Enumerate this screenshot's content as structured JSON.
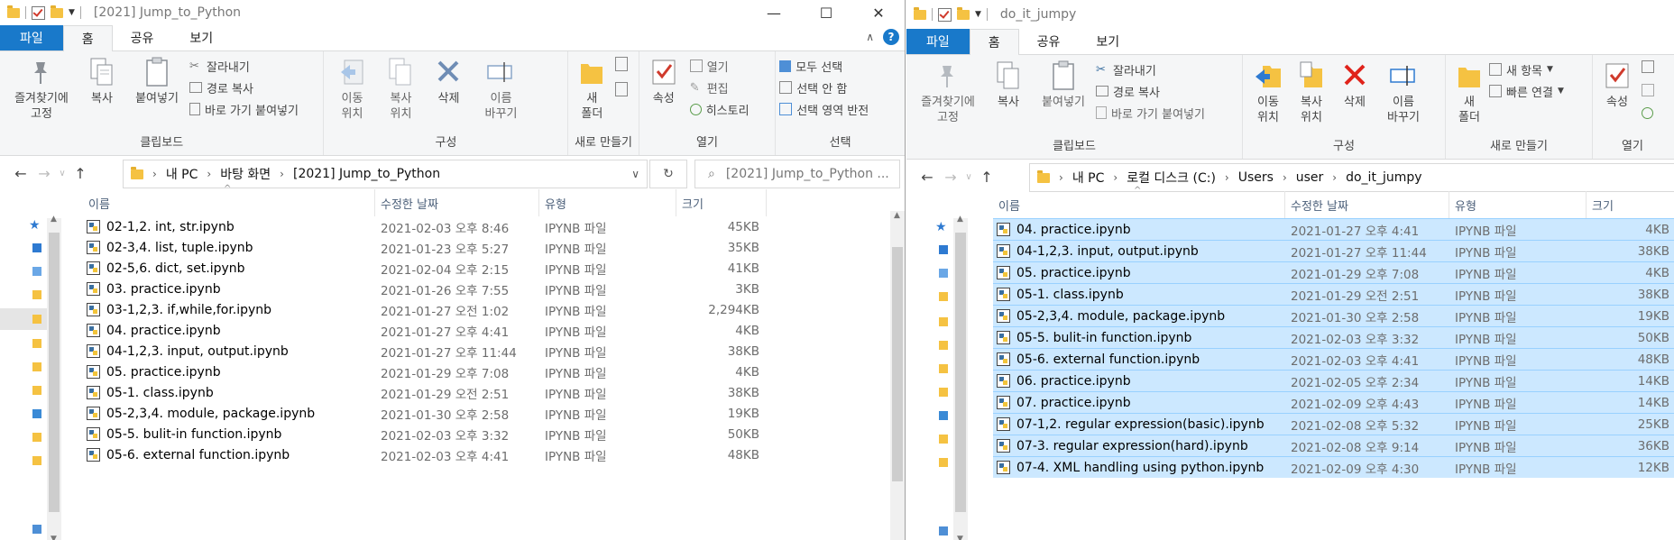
{
  "left": {
    "title": "[2021] Jump_to_Python",
    "tabs": [
      "파일",
      "홈",
      "공유",
      "보기"
    ],
    "ribbon": {
      "clipboard": {
        "pin": "즐겨찾기에\n고정",
        "copy": "복사",
        "paste": "붙여넣기",
        "cut": "잘라내기",
        "copy_path": "경로 복사",
        "paste_shortcut": "바로 가기 붙여넣기",
        "label": "클립보드"
      },
      "organize": {
        "move": "이동\n위치",
        "copyto": "복사\n위치",
        "delete": "삭제",
        "rename": "이름\n바꾸기",
        "label": "구성"
      },
      "new": {
        "folder": "새\n폴더",
        "label": "새로 만들기"
      },
      "open": {
        "props": "속성",
        "open": "열기",
        "edit": "편집",
        "history": "히스토리",
        "label": "열기"
      },
      "select": {
        "all": "모두 선택",
        "none": "선택 안 함",
        "invert": "선택 영역 반전",
        "label": "선택"
      }
    },
    "breadcrumb": [
      "내 PC",
      "바탕 화면",
      "[2021] Jump_to_Python"
    ],
    "search_placeholder": "[2021] Jump_to_Python ...",
    "columns": {
      "name": "이름",
      "date": "수정한 날짜",
      "type": "유형",
      "size": "크기"
    },
    "files": [
      {
        "name": "02-1,2. int, str.ipynb",
        "date": "2021-02-03 오후 8:46",
        "type": "IPYNB 파일",
        "size": "45KB"
      },
      {
        "name": "02-3,4. list, tuple.ipynb",
        "date": "2021-01-23 오후 5:27",
        "type": "IPYNB 파일",
        "size": "35KB"
      },
      {
        "name": "02-5,6. dict, set.ipynb",
        "date": "2021-02-04 오후 2:15",
        "type": "IPYNB 파일",
        "size": "41KB"
      },
      {
        "name": "03. practice.ipynb",
        "date": "2021-01-26 오후 7:55",
        "type": "IPYNB 파일",
        "size": "3KB"
      },
      {
        "name": "03-1,2,3. if,while,for.ipynb",
        "date": "2021-01-27 오전 1:02",
        "type": "IPYNB 파일",
        "size": "2,294KB"
      },
      {
        "name": "04. practice.ipynb",
        "date": "2021-01-27 오후 4:41",
        "type": "IPYNB 파일",
        "size": "4KB"
      },
      {
        "name": "04-1,2,3. input, output.ipynb",
        "date": "2021-01-27 오후 11:44",
        "type": "IPYNB 파일",
        "size": "38KB"
      },
      {
        "name": "05. practice.ipynb",
        "date": "2021-01-29 오후 7:08",
        "type": "IPYNB 파일",
        "size": "4KB"
      },
      {
        "name": "05-1. class.ipynb",
        "date": "2021-01-29 오전 2:51",
        "type": "IPYNB 파일",
        "size": "38KB"
      },
      {
        "name": "05-2,3,4. module, package.ipynb",
        "date": "2021-01-30 오후 2:58",
        "type": "IPYNB 파일",
        "size": "19KB"
      },
      {
        "name": "05-5. bulit-in function.ipynb",
        "date": "2021-02-03 오후 3:32",
        "type": "IPYNB 파일",
        "size": "50KB"
      },
      {
        "name": "05-6. external function.ipynb",
        "date": "2021-02-03 오후 4:41",
        "type": "IPYNB 파일",
        "size": "48KB"
      }
    ]
  },
  "right": {
    "title": "do_it_jumpy",
    "tabs": [
      "파일",
      "홈",
      "공유",
      "보기"
    ],
    "ribbon": {
      "clipboard": {
        "pin": "즐겨찾기에\n고정",
        "copy": "복사",
        "paste": "붙여넣기",
        "cut": "잘라내기",
        "copy_path": "경로 복사",
        "paste_shortcut": "바로 가기 붙여넣기",
        "label": "클립보드"
      },
      "organize": {
        "move": "이동\n위치",
        "copyto": "복사\n위치",
        "delete": "삭제",
        "rename": "이름\n바꾸기",
        "label": "구성"
      },
      "new": {
        "folder": "새\n폴더",
        "new_item": "새 항목",
        "easy_access": "빠른 연결",
        "label": "새로 만들기"
      },
      "open": {
        "props": "속성",
        "label": "열기"
      }
    },
    "breadcrumb": [
      "내 PC",
      "로컬 디스크 (C:)",
      "Users",
      "user",
      "do_it_jumpy"
    ],
    "columns": {
      "name": "이름",
      "date": "수정한 날짜",
      "type": "유형",
      "size": "크기"
    },
    "files": [
      {
        "name": "04. practice.ipynb",
        "date": "2021-01-27 오후 4:41",
        "type": "IPYNB 파일",
        "size": "4KB"
      },
      {
        "name": "04-1,2,3. input, output.ipynb",
        "date": "2021-01-27 오후 11:44",
        "type": "IPYNB 파일",
        "size": "38KB"
      },
      {
        "name": "05. practice.ipynb",
        "date": "2021-01-29 오후 7:08",
        "type": "IPYNB 파일",
        "size": "4KB"
      },
      {
        "name": "05-1. class.ipynb",
        "date": "2021-01-29 오전 2:51",
        "type": "IPYNB 파일",
        "size": "38KB"
      },
      {
        "name": "05-2,3,4. module, package.ipynb",
        "date": "2021-01-30 오후 2:58",
        "type": "IPYNB 파일",
        "size": "19KB"
      },
      {
        "name": "05-5. bulit-in function.ipynb",
        "date": "2021-02-03 오후 3:32",
        "type": "IPYNB 파일",
        "size": "50KB"
      },
      {
        "name": "05-6. external function.ipynb",
        "date": "2021-02-03 오후 4:41",
        "type": "IPYNB 파일",
        "size": "48KB"
      },
      {
        "name": "06. practice.ipynb",
        "date": "2021-02-05 오후 2:34",
        "type": "IPYNB 파일",
        "size": "14KB"
      },
      {
        "name": "07. practice.ipynb",
        "date": "2021-02-09 오후 4:43",
        "type": "IPYNB 파일",
        "size": "14KB"
      },
      {
        "name": "07-1,2. regular expression(basic).ipynb",
        "date": "2021-02-08 오후 5:32",
        "type": "IPYNB 파일",
        "size": "25KB"
      },
      {
        "name": "07-3. regular expression(hard).ipynb",
        "date": "2021-02-08 오후 9:14",
        "type": "IPYNB 파일",
        "size": "36KB"
      },
      {
        "name": "07-4. XML handling using python.ipynb",
        "date": "2021-02-09 오후 4:30",
        "type": "IPYNB 파일",
        "size": "12KB"
      }
    ]
  },
  "colors": {
    "accent": "#1979ca",
    "selection": "#cce8ff",
    "selection_border": "#99d1ff"
  }
}
